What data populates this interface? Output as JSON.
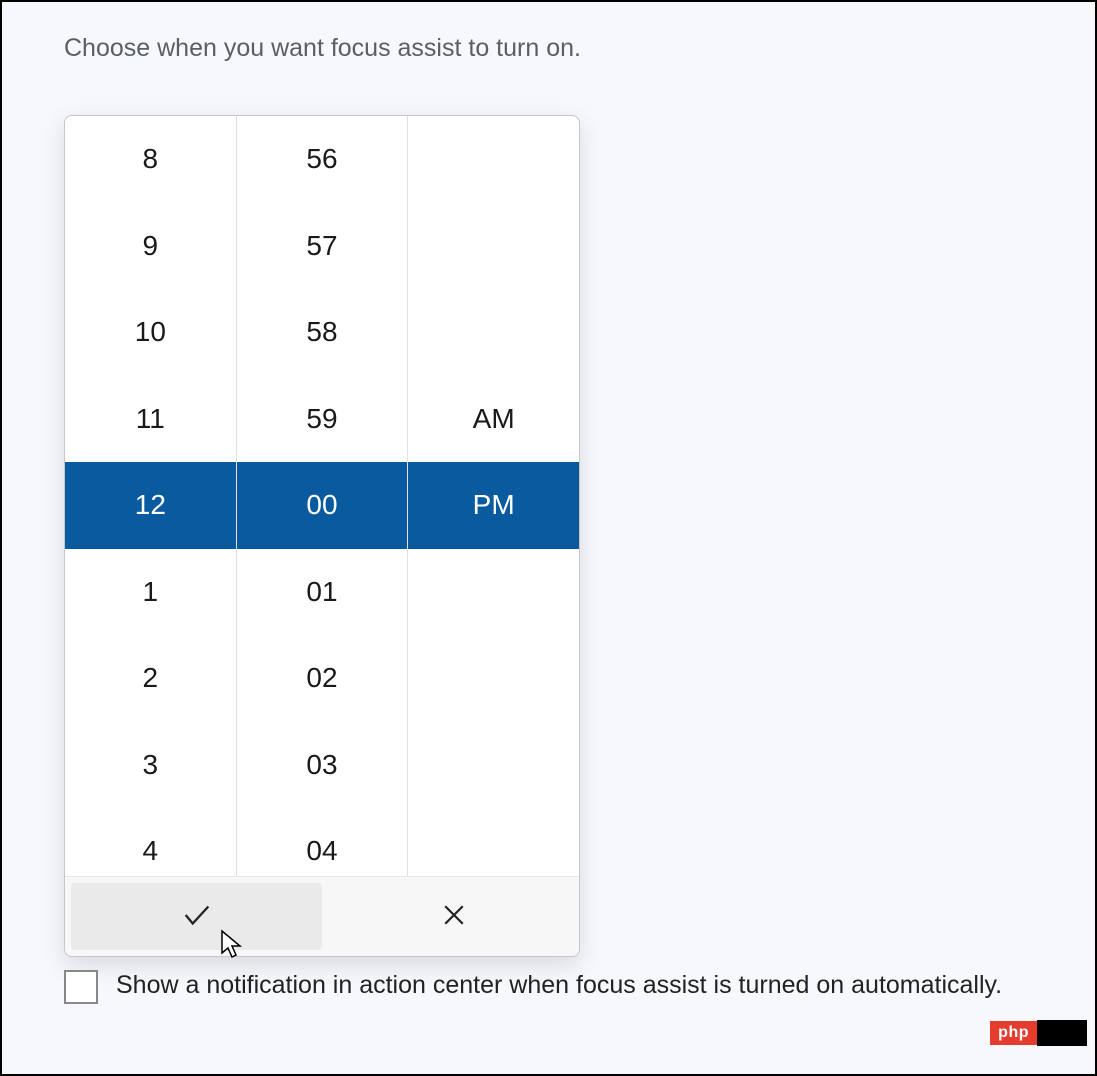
{
  "header": {
    "title": "Choose when you want focus assist to turn on."
  },
  "time_picker": {
    "hours_visible": [
      "8",
      "9",
      "10",
      "11",
      "12",
      "1",
      "2",
      "3",
      "4"
    ],
    "minutes_visible": [
      "56",
      "57",
      "58",
      "59",
      "00",
      "01",
      "02",
      "03",
      "04"
    ],
    "ampm_visible": [
      "AM",
      "PM"
    ],
    "selected_index": 4,
    "ampm_selected_index": 1,
    "selected_hour": "12",
    "selected_minute": "00",
    "selected_ampm": "PM"
  },
  "checkbox": {
    "label": "Show a notification in action center when focus assist is turned on automatically.",
    "checked": false
  },
  "watermark": {
    "text": "php"
  }
}
